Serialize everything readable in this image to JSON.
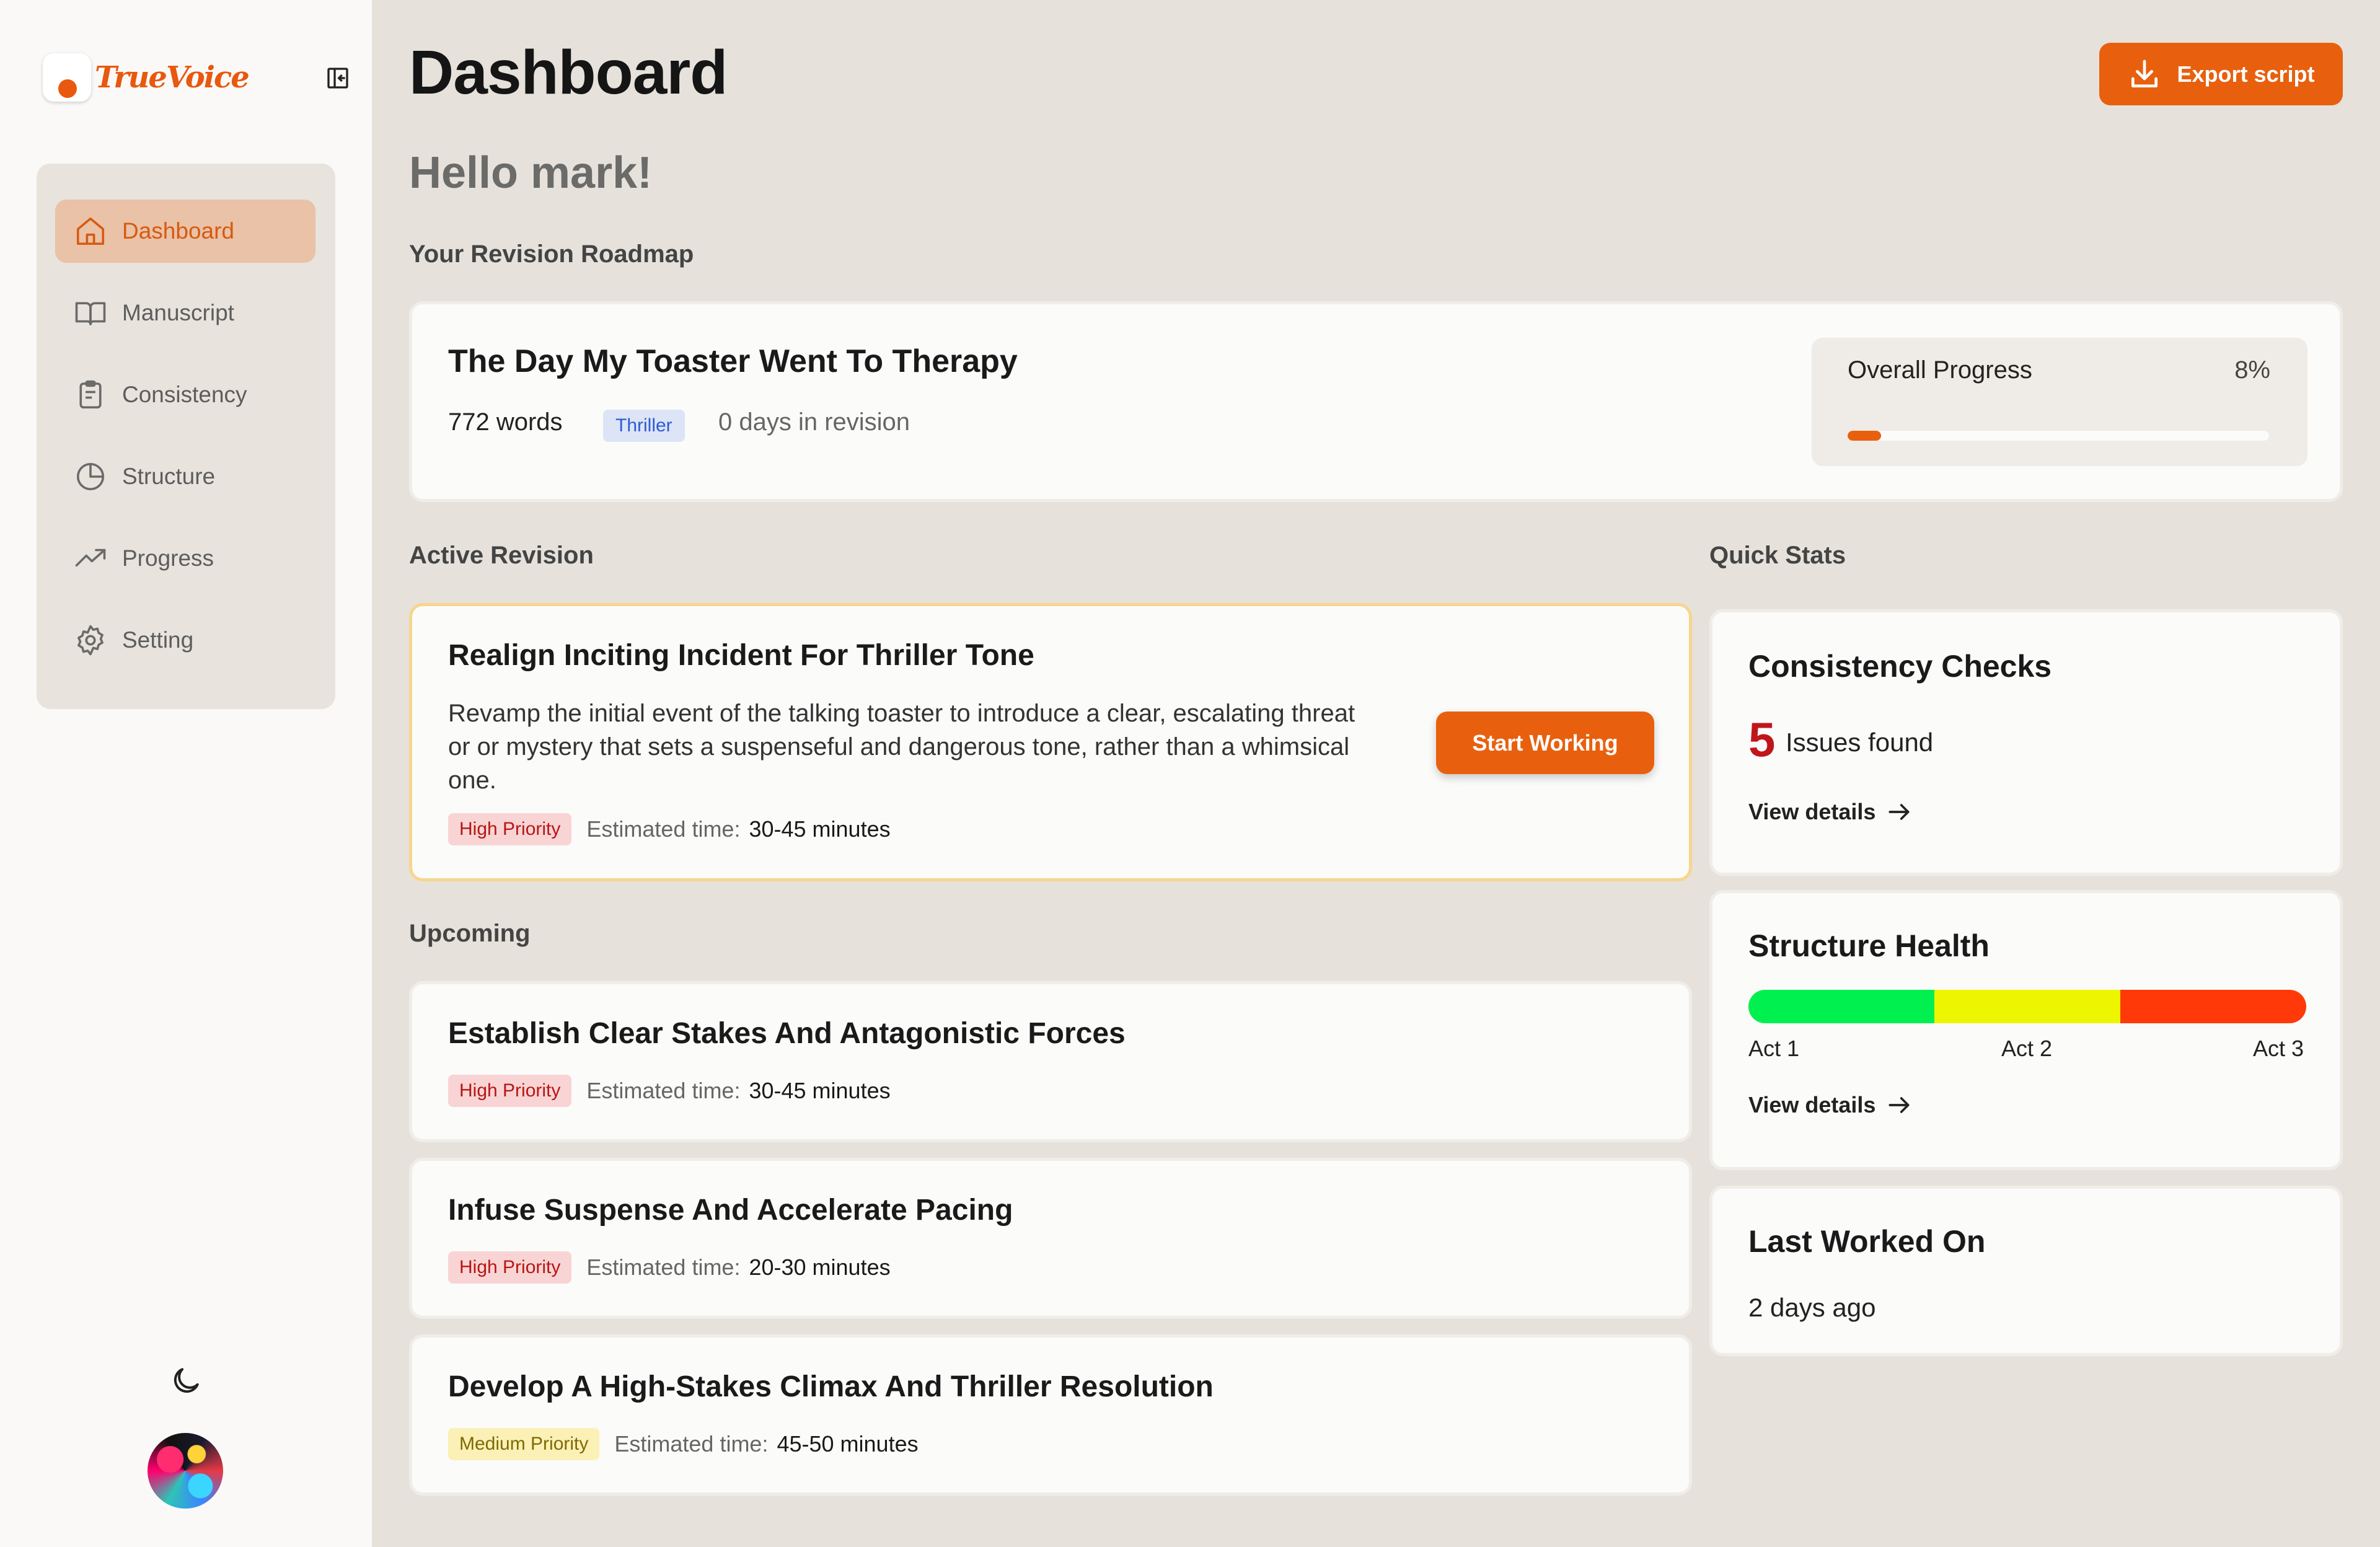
{
  "app": {
    "name": "TrueVoice"
  },
  "sidebar": {
    "items": [
      {
        "label": "Dashboard",
        "icon": "home-icon",
        "active": true
      },
      {
        "label": "Manuscript",
        "icon": "book-icon",
        "active": false
      },
      {
        "label": "Consistency",
        "icon": "clipboard-icon",
        "active": false
      },
      {
        "label": "Structure",
        "icon": "pie-chart-icon",
        "active": false
      },
      {
        "label": "Progress",
        "icon": "trend-up-icon",
        "active": false
      },
      {
        "label": "Setting",
        "icon": "gear-icon",
        "active": false
      }
    ]
  },
  "header": {
    "title": "Dashboard",
    "export_label": "Export script"
  },
  "greeting": "Hello mark!",
  "roadmap": {
    "section_label": "Your Revision Roadmap",
    "title": "The Day My Toaster Went To Therapy",
    "words": "772 words",
    "genre": "Thriller",
    "days": "0 days in revision",
    "progress_label": "Overall Progress",
    "progress_text": "8%",
    "progress_value": 0.08
  },
  "active": {
    "section_label": "Active Revision",
    "title": "Realign Inciting Incident For Thriller Tone",
    "description": "Revamp the initial event of the talking toaster to introduce a clear, escalating threat or or mystery that sets a suspenseful and dangerous tone, rather than a whimsical one.",
    "priority": "High Priority",
    "est_label": "Estimated time:",
    "est_value": "30-45 minutes",
    "button": "Start Working"
  },
  "upcoming": {
    "section_label": "Upcoming",
    "items": [
      {
        "title": "Establish Clear Stakes And Antagonistic Forces",
        "priority": "High Priority",
        "est_label": "Estimated time:",
        "est_value": "30-45 minutes"
      },
      {
        "title": "Infuse Suspense And Accelerate Pacing",
        "priority": "High Priority",
        "est_label": "Estimated time:",
        "est_value": "20-30 minutes"
      },
      {
        "title": "Develop A High-Stakes Climax And Thriller Resolution",
        "priority": "Medium Priority",
        "est_label": "Estimated time:",
        "est_value": "45-50 minutes"
      }
    ]
  },
  "stats": {
    "section_label": "Quick Stats",
    "consistency": {
      "title": "Consistency Checks",
      "count": "5",
      "issues_label": "Issues found",
      "link": "View details"
    },
    "structure": {
      "title": "Structure Health",
      "acts": [
        "Act 1",
        "Act 2",
        "Act 3"
      ],
      "colors": [
        "#00f050",
        "#eef500",
        "#ff3a08"
      ],
      "link": "View details"
    },
    "last_worked": {
      "title": "Last Worked On",
      "value": "2 days ago"
    }
  },
  "colors": {
    "accent": "#e8600e",
    "background": "#e6e2db",
    "card": "#fbfbfa"
  }
}
